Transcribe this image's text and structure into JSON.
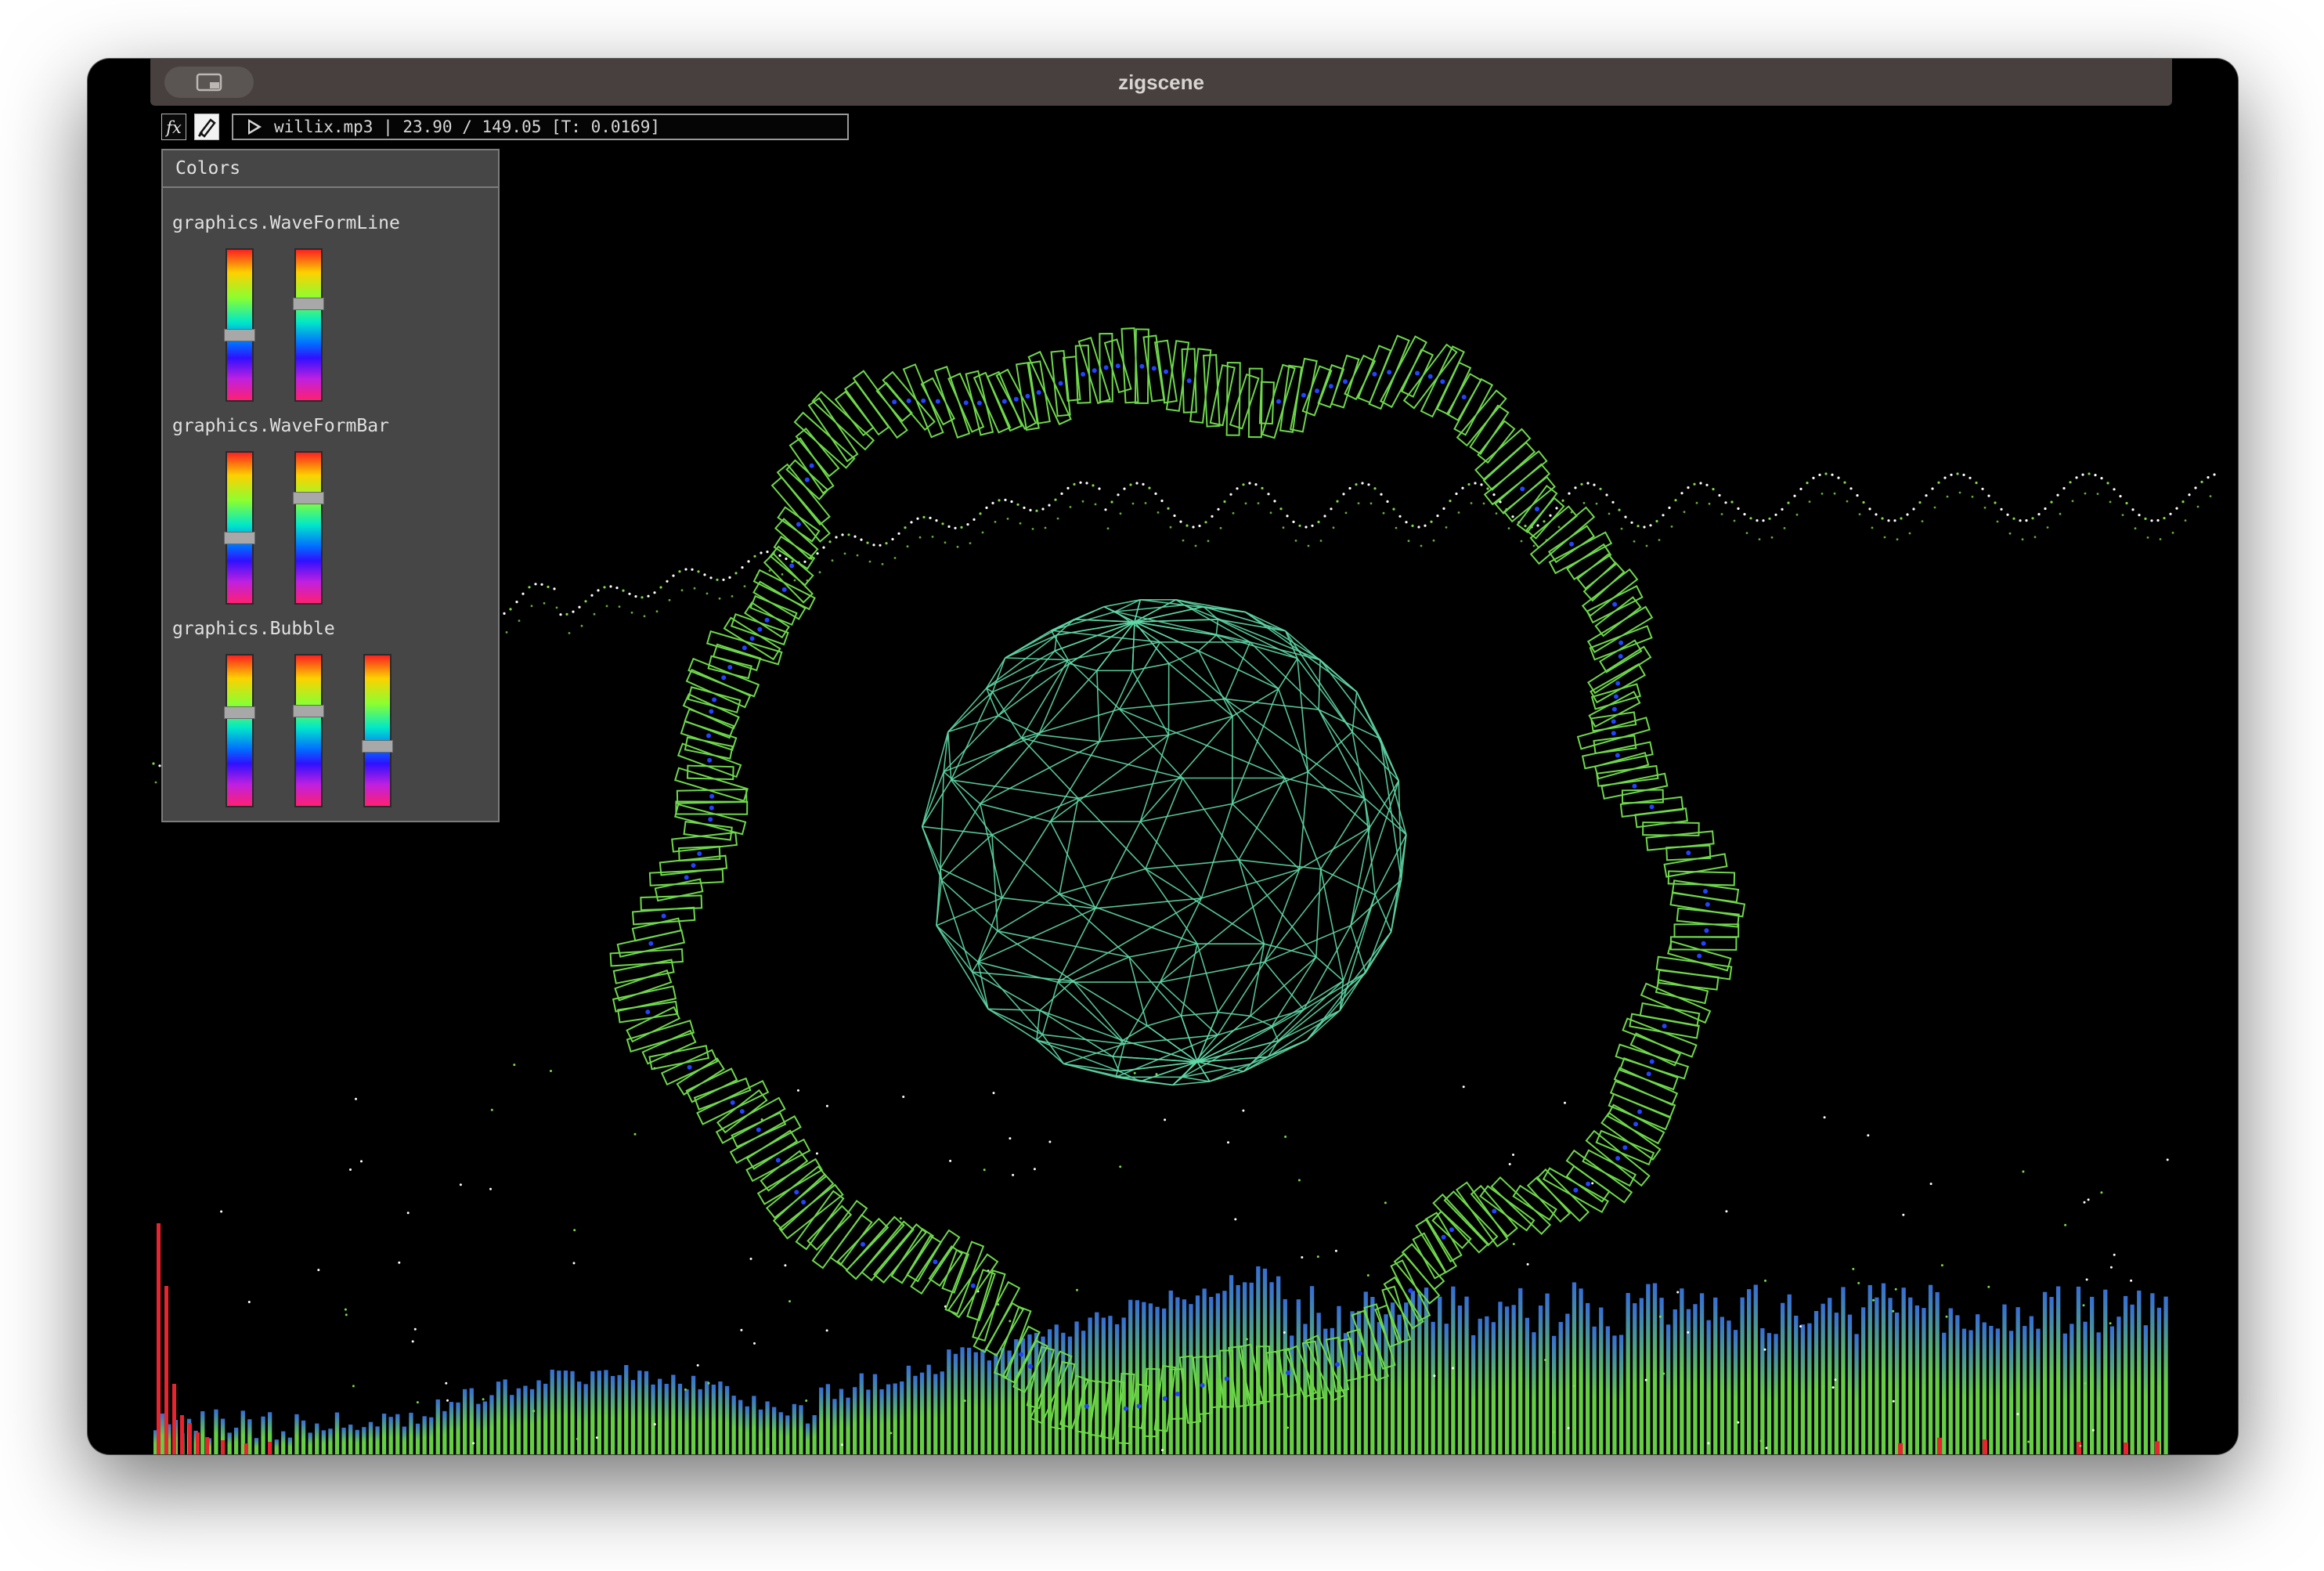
{
  "window": {
    "title": "zigscene"
  },
  "toolbar": {
    "fx_icon": "fx-icon",
    "palette_icon": "palette-icon",
    "play_icon": "play-icon",
    "track_info": "willix.mp3 | 23.90 / 149.05 [T: 0.0169]"
  },
  "colors_panel": {
    "title": "Colors",
    "sections": [
      {
        "label": "graphics.WaveFormLine",
        "slider_values": [
          0.56,
          0.34
        ]
      },
      {
        "label": "graphics.WaveFormBar",
        "slider_values": [
          0.56,
          0.28
        ]
      },
      {
        "label": "graphics.Bubble",
        "slider_values": [
          0.36,
          0.35,
          0.6
        ]
      }
    ]
  },
  "scene": {
    "sphere_color": "#5fd9a6",
    "ring_color": "#6ed84a",
    "ring_accent_color": "#2244ff",
    "spectrum_low_color": "#6ee04a",
    "spectrum_high_color": "#3a78e8",
    "spectrum_peak_color": "#e8242e",
    "dots_color": "#ffffff",
    "dots_alt_color": "#7ed84a"
  }
}
